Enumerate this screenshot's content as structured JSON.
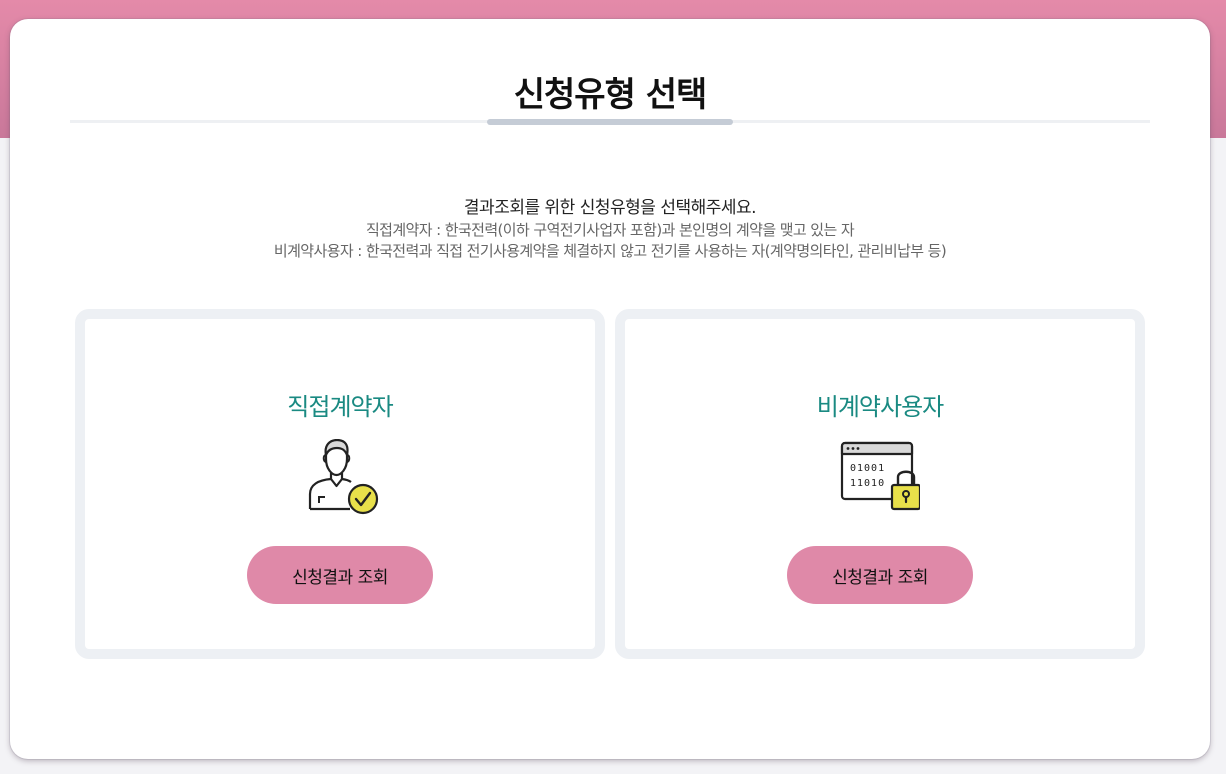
{
  "page": {
    "title": "신청유형 선택"
  },
  "intro": {
    "main": "결과조회를 위한 신청유형을 선택해주세요.",
    "line1": "직접계약자 : 한국전력(이하 구역전기사업자 포함)과 본인명의 계약을 맺고 있는 자",
    "line2": "비계약사용자 : 한국전력과 직접 전기사용계약을 체결하지 않고 전기를 사용하는 자(계약명의타인, 관리비납부 등)"
  },
  "cards": [
    {
      "title": "직접계약자",
      "icon": "user-check-icon",
      "button_label": "신청결과 조회"
    },
    {
      "title": "비계약사용자",
      "icon": "secure-data-lock-icon",
      "button_label": "신청결과 조회"
    }
  ],
  "colors": {
    "brand_pink": "#df89a8",
    "accent_teal": "#1a8a82",
    "icon_yellow": "#e8e04a"
  }
}
